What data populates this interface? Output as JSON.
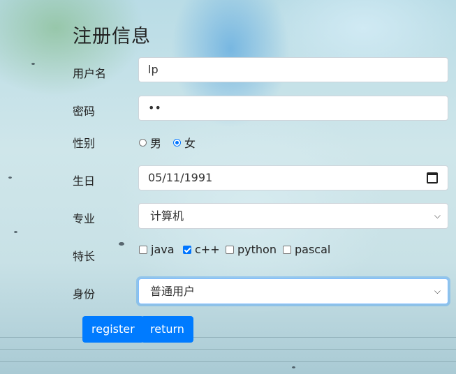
{
  "form": {
    "title": "注册信息",
    "username": {
      "label": "用户名",
      "value": "lp"
    },
    "password": {
      "label": "密码",
      "value": "••"
    },
    "gender": {
      "label": "性别",
      "options": [
        {
          "label": "男",
          "checked": false
        },
        {
          "label": "女",
          "checked": true
        }
      ]
    },
    "birthday": {
      "label": "生日",
      "value": "05/11/1991",
      "icon": "calendar-icon"
    },
    "major": {
      "label": "专业",
      "selected": "计算机"
    },
    "skills": {
      "label": "特长",
      "options": [
        {
          "label": "java",
          "checked": false
        },
        {
          "label": "c++",
          "checked": true
        },
        {
          "label": "python",
          "checked": false
        },
        {
          "label": "pascal",
          "checked": false
        }
      ]
    },
    "identity": {
      "label": "身份",
      "selected": "普通用户"
    },
    "buttons": {
      "register": "register",
      "return": "return"
    }
  },
  "colors": {
    "primary": "#007bff",
    "checked": "#0075ff"
  }
}
